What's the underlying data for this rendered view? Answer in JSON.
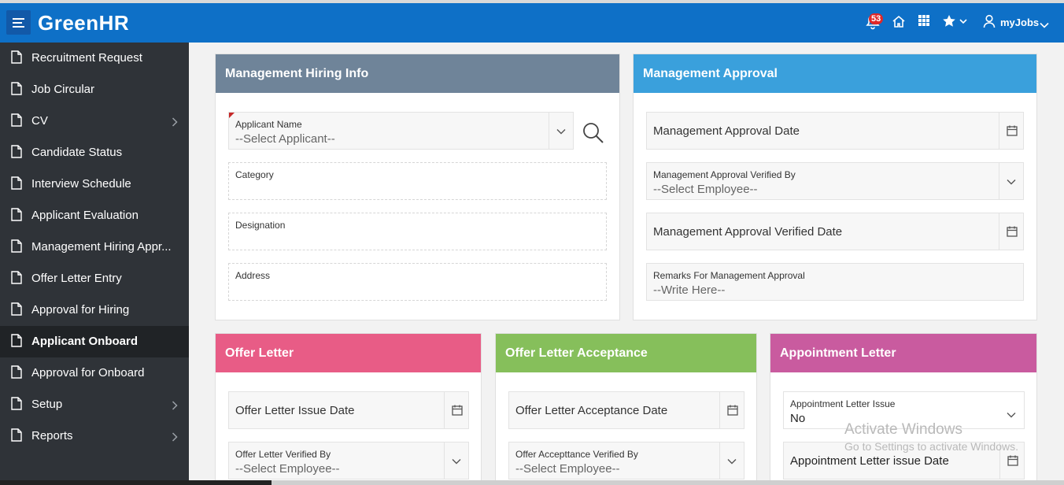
{
  "app": {
    "title": "GreenHR"
  },
  "topbar": {
    "notification_count": "53",
    "user_label": "myJobs"
  },
  "sidebar": {
    "items": [
      {
        "label": "Recruitment Request",
        "submenu": false,
        "active": false
      },
      {
        "label": "Job Circular",
        "submenu": false,
        "active": false
      },
      {
        "label": "CV",
        "submenu": true,
        "active": false
      },
      {
        "label": "Candidate Status",
        "submenu": false,
        "active": false
      },
      {
        "label": "Interview Schedule",
        "submenu": false,
        "active": false
      },
      {
        "label": "Applicant Evaluation",
        "submenu": false,
        "active": false
      },
      {
        "label": "Management Hiring Appr...",
        "submenu": false,
        "active": false
      },
      {
        "label": "Offer Letter Entry",
        "submenu": false,
        "active": false
      },
      {
        "label": "Approval for Hiring",
        "submenu": false,
        "active": false
      },
      {
        "label": "Applicant Onboard",
        "submenu": false,
        "active": true
      },
      {
        "label": "Approval for Onboard",
        "submenu": false,
        "active": false
      },
      {
        "label": "Setup",
        "submenu": true,
        "active": false
      },
      {
        "label": "Reports",
        "submenu": true,
        "active": false
      }
    ]
  },
  "hiring_info": {
    "title": "Management Hiring Info",
    "color": "#6f8499",
    "applicant_label": "Applicant Name",
    "applicant_value": "--Select Applicant--",
    "category_label": "Category",
    "designation_label": "Designation",
    "address_label": "Address"
  },
  "approval": {
    "title": "Management Approval",
    "color": "#3aa0dc",
    "approval_date": "Management Approval Date",
    "verified_by_label": "Management Approval Verified By",
    "verified_by_value": "--Select Employee--",
    "verified_date": "Management Approval Verified Date",
    "remarks_label": "Remarks For Management Approval",
    "remarks_placeholder": "--Write Here--"
  },
  "offer_letter": {
    "title": "Offer Letter",
    "color": "#e85c86",
    "issue_date": "Offer Letter Issue Date",
    "verified_by_label": "Offer Letter Verified By",
    "verified_by_value": "--Select Employee--"
  },
  "offer_acceptance": {
    "title": "Offer Letter Acceptance",
    "color": "#86bf5b",
    "acceptance_date": "Offer Letter Acceptance Date",
    "verified_by_label": "Offer Accepttance Verified By",
    "verified_by_value": "--Select Employee--"
  },
  "appointment": {
    "title": "Appointment Letter",
    "color": "#c95b9f",
    "issue_label": "Appointment Letter Issue",
    "issue_value": "No",
    "issue_date": "Appointment Letter issue Date"
  },
  "watermark": {
    "line1": "Activate Windows",
    "line2": "Go to Settings to activate Windows."
  }
}
